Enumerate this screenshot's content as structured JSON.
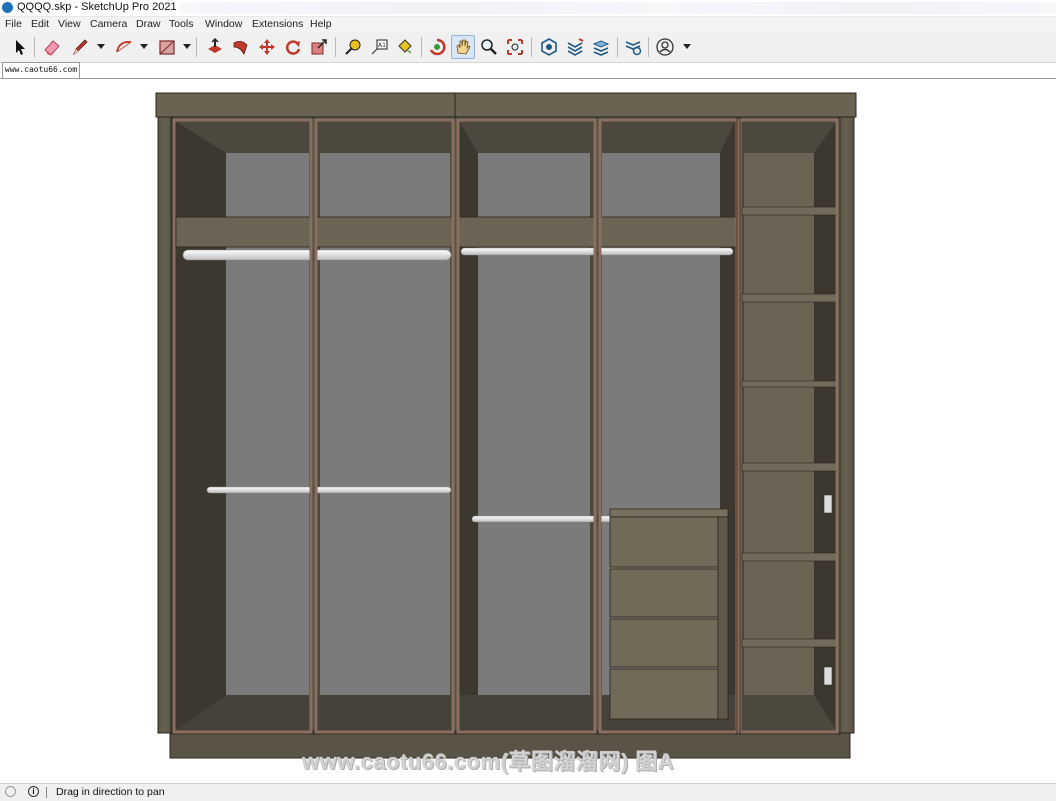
{
  "window": {
    "title": "QQQQ.skp - SketchUp Pro 2021"
  },
  "menu": [
    "File",
    "Edit",
    "View",
    "Camera",
    "Draw",
    "Tools",
    "Window",
    "Extensions",
    "Help"
  ],
  "toolbar": {
    "tools": [
      {
        "name": "select-tool-icon"
      },
      {
        "name": "eraser-tool-icon"
      },
      {
        "name": "pencil-line-tool-icon"
      },
      {
        "name": "arc-tool-icon"
      },
      {
        "name": "rectangle-tool-icon"
      },
      {
        "name": "push-pull-tool-icon"
      },
      {
        "name": "follow-me-tool-icon"
      },
      {
        "name": "move-tool-icon"
      },
      {
        "name": "rotate-tool-icon"
      },
      {
        "name": "scale-tool-icon"
      },
      {
        "name": "tape-measure-tool-icon"
      },
      {
        "name": "text-tool-icon"
      },
      {
        "name": "paint-bucket-tool-icon"
      },
      {
        "name": "orbit-tool-icon"
      },
      {
        "name": "pan-tool-icon",
        "active": true
      },
      {
        "name": "zoom-tool-icon"
      },
      {
        "name": "zoom-extents-tool-icon"
      },
      {
        "name": "3d-warehouse-icon"
      },
      {
        "name": "extension-warehouse-icon"
      },
      {
        "name": "layout-icon"
      },
      {
        "name": "extension-manager-icon"
      },
      {
        "name": "account-icon"
      }
    ],
    "text_tool_label": "A1"
  },
  "scene_tab": {
    "label": "www.caotu66.com"
  },
  "viewport": {
    "watermark": "www.caotu66.com(草图溜溜网) 图A",
    "colors": {
      "wood": "#615a4b",
      "wood_dark": "#3f3b32",
      "interior": "#4a463c",
      "back_panel": "#7b7b7b",
      "rod": "#eeeeee",
      "frame": "#8a6e5e"
    }
  },
  "status": {
    "message": "Drag in direction to pan",
    "info_icon": "i"
  }
}
